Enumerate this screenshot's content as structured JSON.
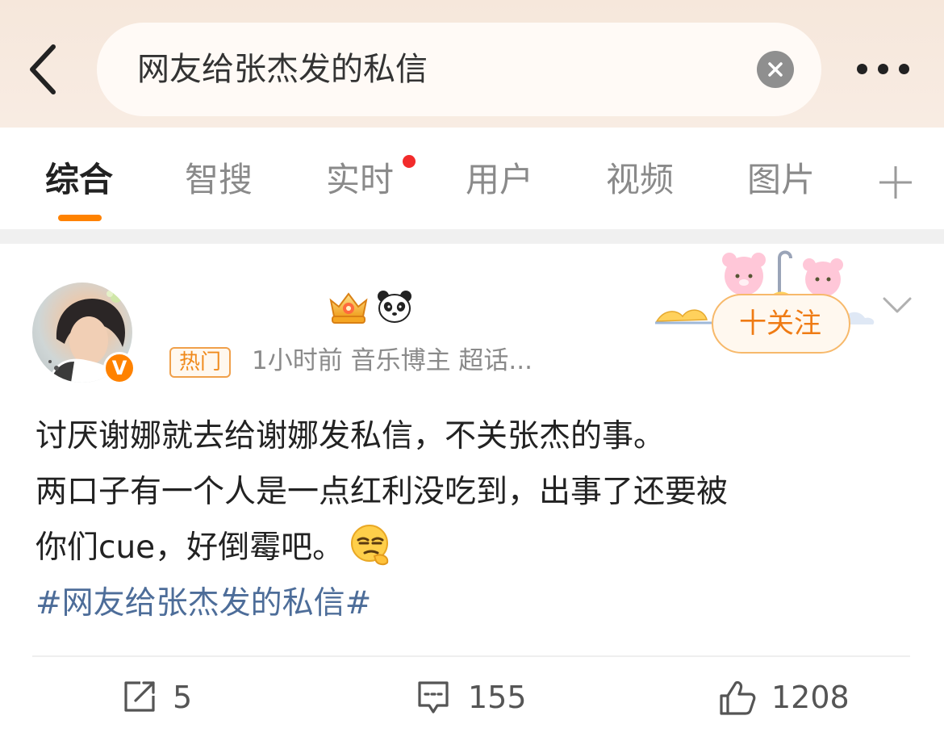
{
  "search": {
    "query": "网友给张杰发的私信"
  },
  "tabs": [
    {
      "label": "综合",
      "active": true
    },
    {
      "label": "智搜"
    },
    {
      "label": "实时",
      "has_red_dot": true
    },
    {
      "label": "用户"
    },
    {
      "label": "视频"
    },
    {
      "label": "图片"
    }
  ],
  "post": {
    "hot_tag": "热门",
    "meta": "1小时前  音乐博主 超话...",
    "follow_label": "十关注",
    "verify_badge": "V",
    "lines": [
      "讨厌谢娜就去给谢娜发私信，不关张杰的事。",
      "两口子有一个人是一点红利没吃到，出事了还要被",
      "你们cue，好倒霉吧。"
    ],
    "hashtag": "#网友给张杰发的私信#",
    "stats": {
      "reposts": "5",
      "comments": "155",
      "likes": "1208"
    }
  },
  "colors": {
    "accent": "#ff8200",
    "hashtag": "#4d6d99",
    "red_dot": "#f22b2b",
    "follow_text": "#ef7b14"
  },
  "icons": [
    "back-chevron-icon",
    "clear-icon",
    "more-dots-icon",
    "add-tab-icon",
    "crown-badge-icon",
    "panda-icon",
    "chevron-down-icon",
    "repost-icon",
    "comment-icon",
    "like-icon",
    "smirk-emoji"
  ]
}
